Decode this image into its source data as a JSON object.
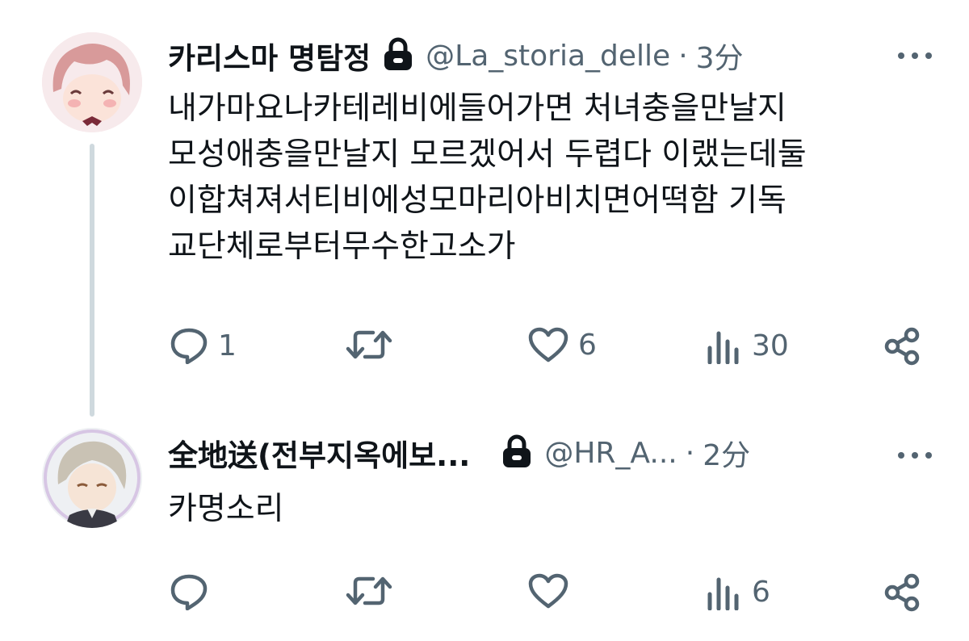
{
  "tweets": [
    {
      "display_name": "카리스마 명탐정",
      "handle": "@La_storia_delle",
      "separator": "·",
      "time": "3分",
      "text": "내가마요나카테레비에들어가면 처녀충을만날지\n모성애충을만날지 모르겠어서 두렵다 이랬는데둘\n이합쳐져서티비에성모마리아비치면어떡함 기독\n교단체로부터무수한고소가",
      "protected": true,
      "avatar_icon": "pink-hair-character-avatar",
      "counts": {
        "reply": "1",
        "retweet": "",
        "like": "6",
        "views": "30"
      }
    },
    {
      "display_name": "全地送(전부지옥에보...",
      "handle": "@HR_A...",
      "separator": "·",
      "time": "2分",
      "text": "카명소리",
      "protected": true,
      "avatar_icon": "silver-hair-character-avatar",
      "counts": {
        "reply": "",
        "retweet": "",
        "like": "",
        "views": "6"
      }
    }
  ],
  "colors": {
    "text": "#0f1419",
    "secondary": "#536471",
    "thread_line": "#cfd9de"
  }
}
